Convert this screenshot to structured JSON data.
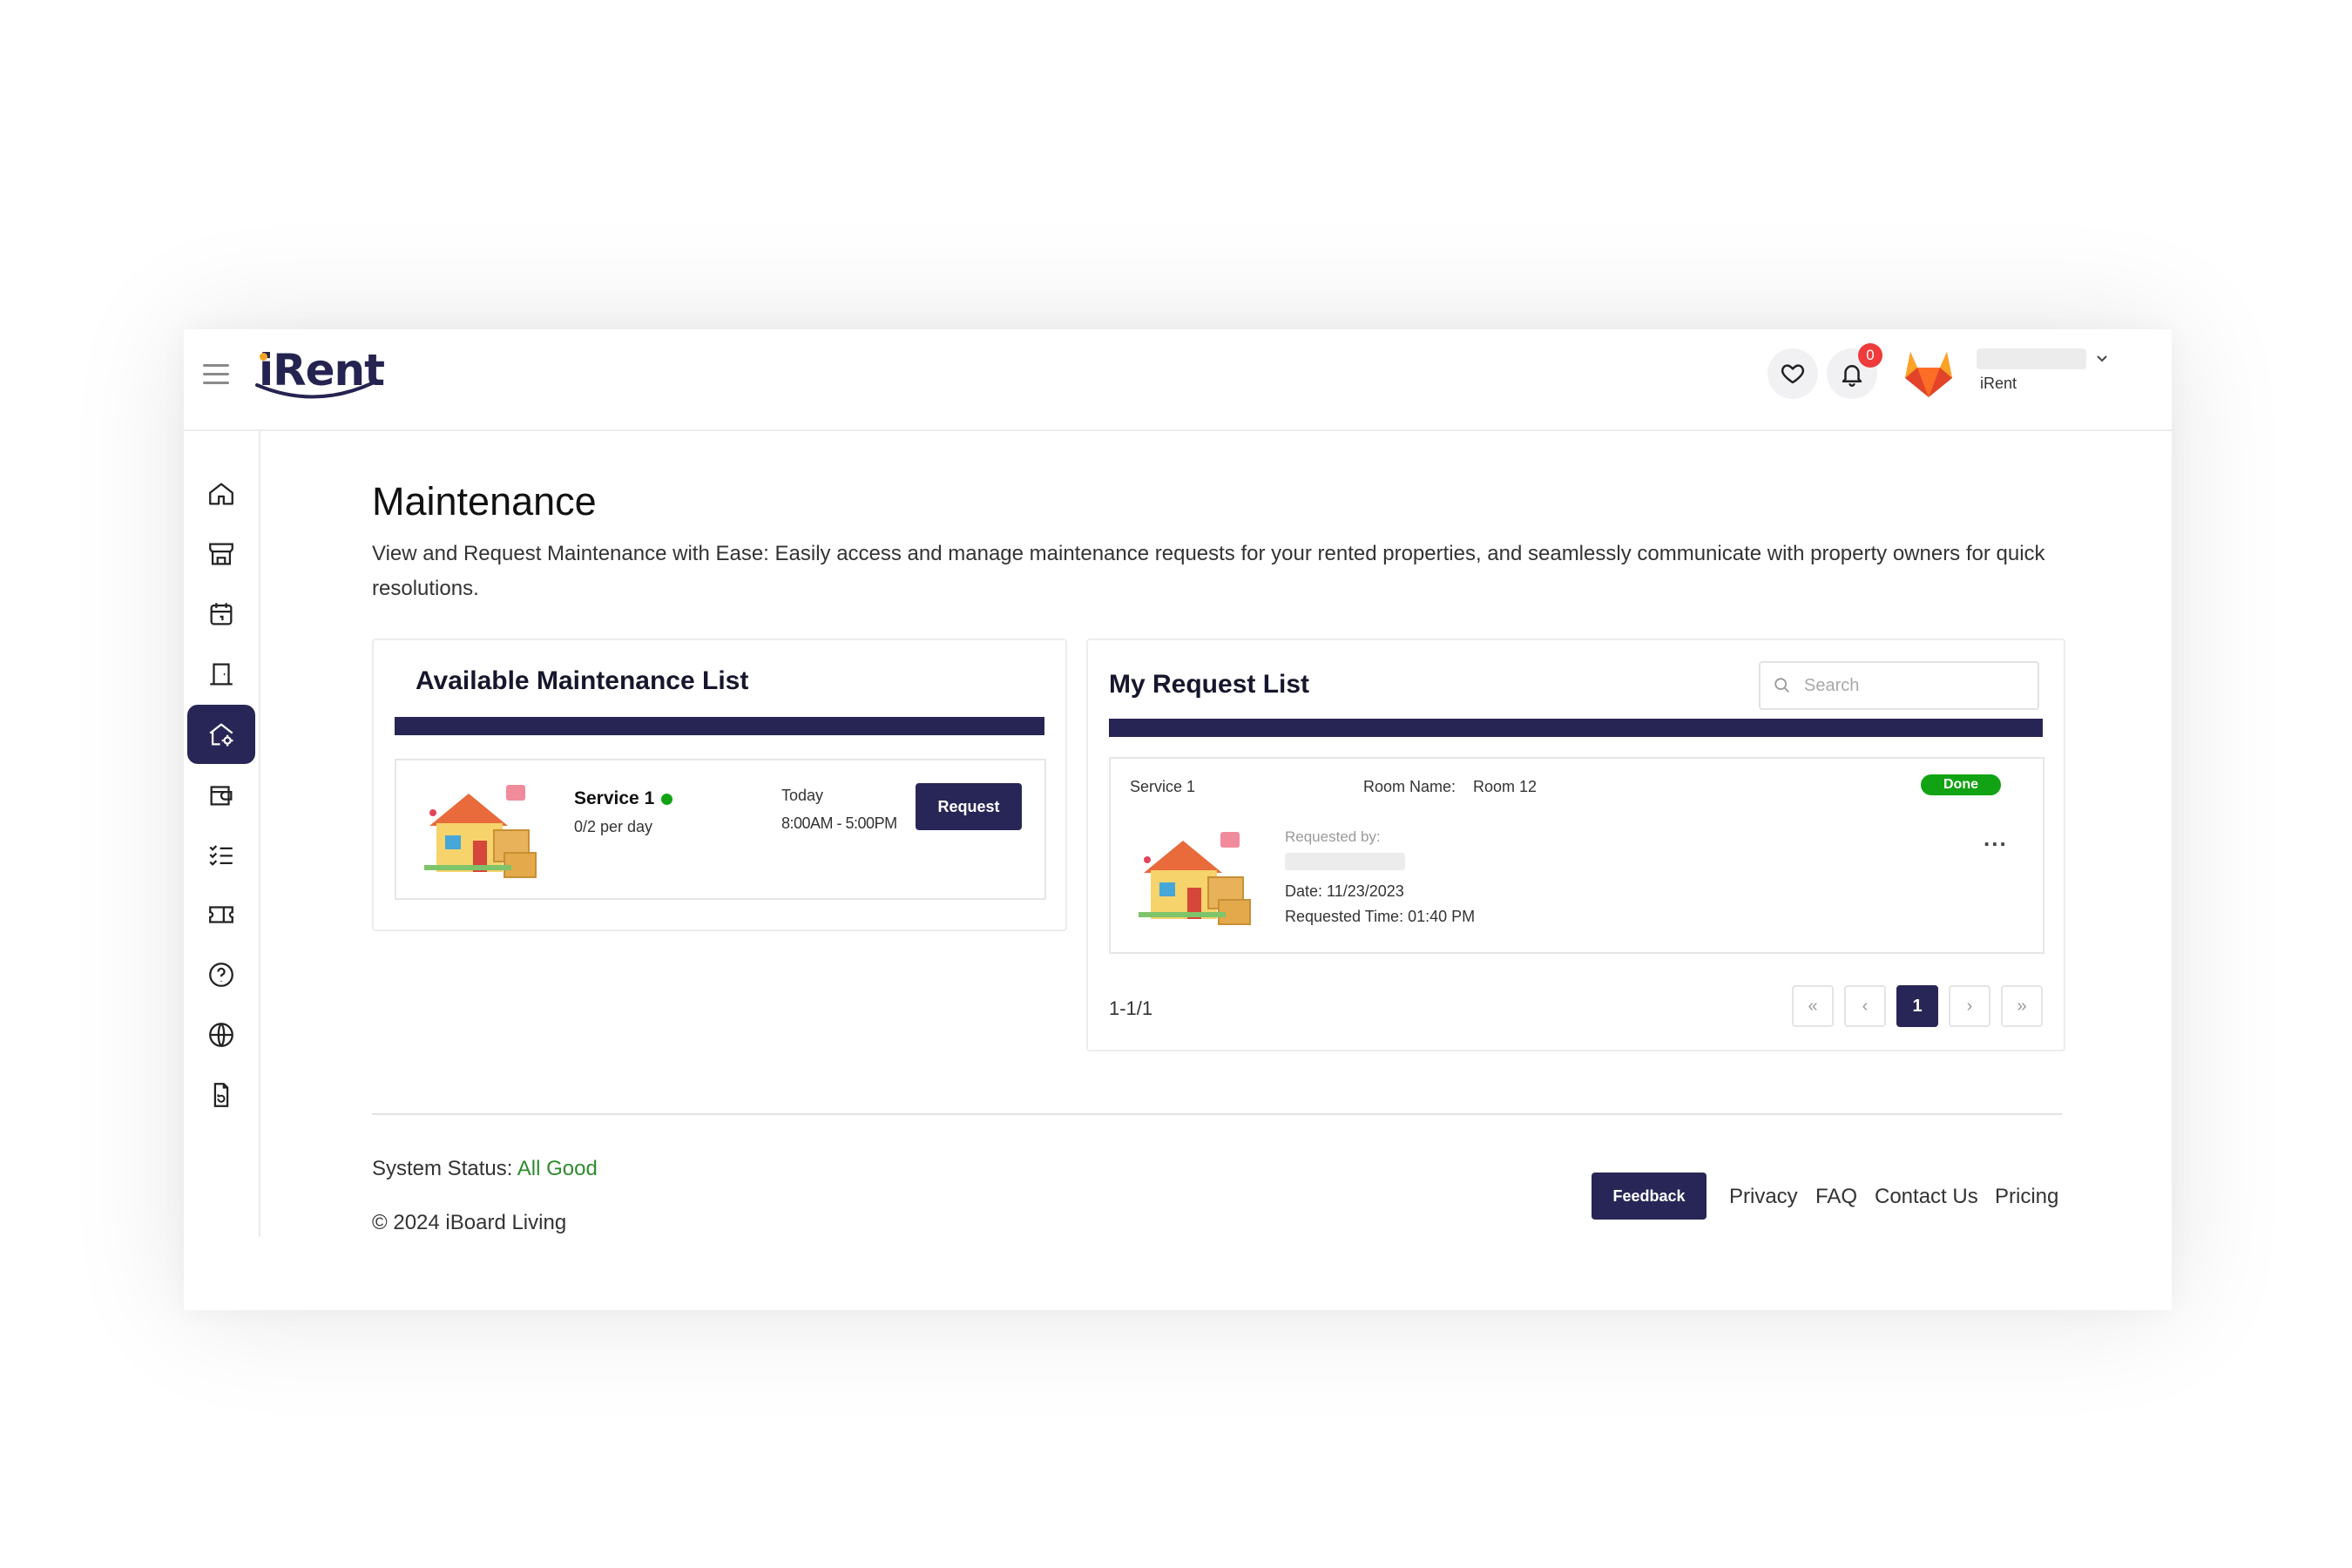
{
  "app": {
    "name": "iRent"
  },
  "header": {
    "notification_count": "0",
    "username_sub": "iRent"
  },
  "sidebar": {
    "items": [
      {
        "icon": "home-icon"
      },
      {
        "icon": "store-icon"
      },
      {
        "icon": "calendar-icon"
      },
      {
        "icon": "door-icon"
      },
      {
        "icon": "home-settings-icon",
        "active": true
      },
      {
        "icon": "wallet-icon"
      },
      {
        "icon": "checklist-icon"
      },
      {
        "icon": "ticket-icon"
      },
      {
        "icon": "help-icon"
      },
      {
        "icon": "globe-icon"
      },
      {
        "icon": "document-refresh-icon"
      }
    ]
  },
  "page": {
    "title": "Maintenance",
    "description": "View and Request Maintenance with Ease: Easily access and manage maintenance requests for your rented properties, and seamlessly communicate with property owners for quick resolutions."
  },
  "available": {
    "title": "Available Maintenance List",
    "item": {
      "name": "Service 1",
      "quota": "0/2 per day",
      "day": "Today",
      "hours": "8:00AM - 5:00PM",
      "button": "Request",
      "status_color": "#11a314"
    }
  },
  "requests": {
    "title": "My Request List",
    "search_placeholder": "Search",
    "item": {
      "service": "Service 1",
      "room_label": "Room Name:",
      "room_value": "Room 12",
      "status": "Done",
      "requested_by_label": "Requested by:",
      "date": "Date: 11/23/2023",
      "time": "Requested Time: 01:40 PM",
      "more": "..."
    },
    "range": "1-1/1",
    "pagination": {
      "first": "«",
      "prev": "‹",
      "current": "1",
      "next": "›",
      "last": "»"
    }
  },
  "footer": {
    "status_label": "System Status:",
    "status_value": "All Good",
    "status_color": "#2e8b2e",
    "copyright": "© 2024 iBoard Living",
    "feedback": "Feedback",
    "links": [
      "Privacy",
      "FAQ",
      "Contact Us",
      "Pricing"
    ]
  },
  "colors": {
    "primary": "#282656",
    "success": "#11a314",
    "danger": "#ef3b3b"
  }
}
